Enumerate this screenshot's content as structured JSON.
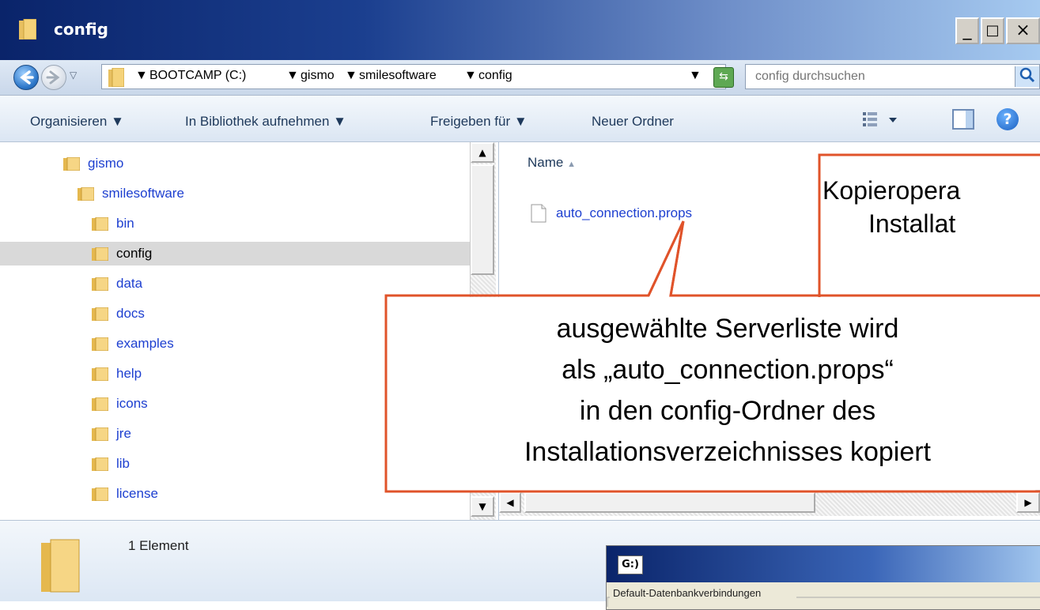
{
  "window": {
    "title": "config",
    "controls": [
      "_",
      "□",
      "×"
    ]
  },
  "address": {
    "crumbs": [
      "BOOTCAMP (C:)",
      "gismo",
      "smilesoftware",
      "config"
    ],
    "search_placeholder": "config durchsuchen"
  },
  "toolbar": {
    "organize": "Organisieren",
    "library": "In Bibliothek aufnehmen",
    "share": "Freigeben für",
    "new_folder": "Neuer Ordner"
  },
  "tree": {
    "items": [
      {
        "label": "gismo",
        "level": 0
      },
      {
        "label": "smilesoftware",
        "level": 1
      },
      {
        "label": "bin",
        "level": 2
      },
      {
        "label": "config",
        "level": 2,
        "selected": true
      },
      {
        "label": "data",
        "level": 2
      },
      {
        "label": "docs",
        "level": 2
      },
      {
        "label": "examples",
        "level": 2
      },
      {
        "label": "help",
        "level": 2
      },
      {
        "label": "icons",
        "level": 2
      },
      {
        "label": "jre",
        "level": 2
      },
      {
        "label": "lib",
        "level": 2
      },
      {
        "label": "license",
        "level": 2
      }
    ]
  },
  "files": {
    "column_name": "Name",
    "items": [
      {
        "name": "auto_connection.props"
      }
    ]
  },
  "details": {
    "count": "1 Element"
  },
  "callouts": {
    "top_right": {
      "line1": "Kopieropera",
      "line2": "Installat"
    },
    "main": {
      "line1": "ausgewählte Serverliste wird",
      "line2": "als „auto_connection.props“",
      "line3": "in den config-Ordner des",
      "line4": "Installationsverzeichnisses kopiert"
    }
  },
  "overlay_app": {
    "logo": "G:)",
    "group_label": "Default-Datenbankverbindungen"
  },
  "colors": {
    "callout_border": "#e0532a",
    "tree_link": "#1d3fd0",
    "selected_bg": "#d9d9d9"
  }
}
